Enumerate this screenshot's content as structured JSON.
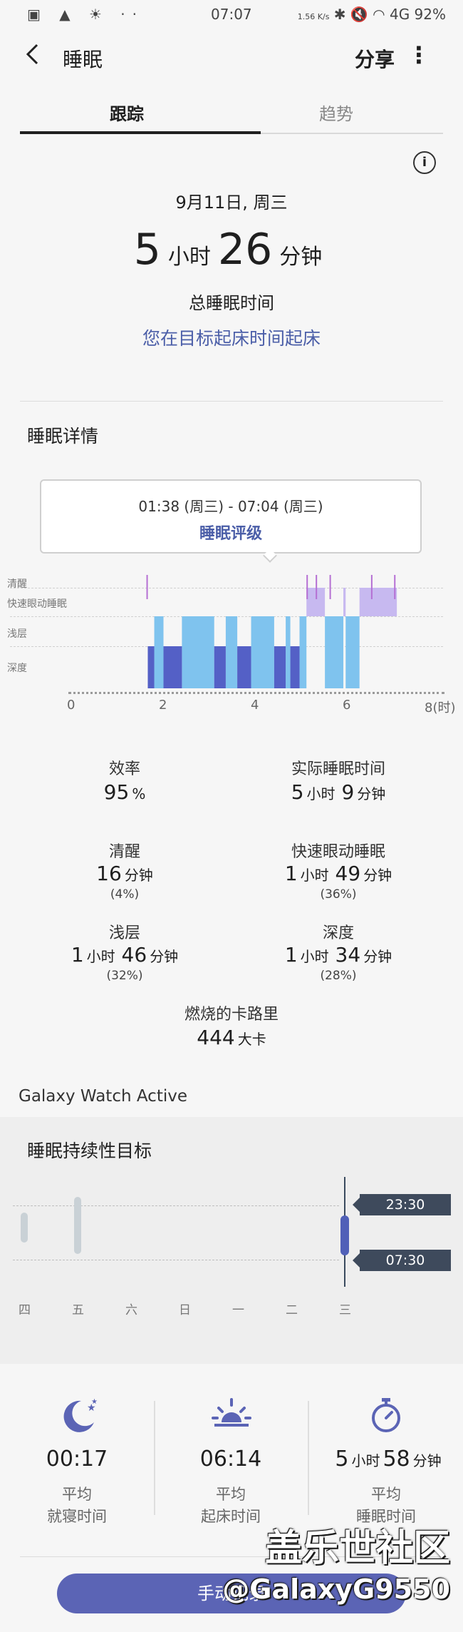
{
  "status_bar": {
    "left_icons": "▣ ▲ ☀ ··",
    "time": "07:07",
    "net_speed": "1.56 K/s",
    "right_icons": "✱ 🔇 ◠ 4G",
    "battery": "92%"
  },
  "header": {
    "title": "睡眠",
    "share_label": "分享"
  },
  "tabs": [
    {
      "label": "跟踪"
    },
    {
      "label": "趋势"
    }
  ],
  "summary": {
    "date": "9月11日, 周三",
    "hours": "5",
    "hours_unit": "小时",
    "minutes": "26",
    "minutes_unit": "分钟",
    "total_label": "总睡眠时间",
    "wake_message": "您在目标起床时间起床"
  },
  "details": {
    "title": "睡眠详情",
    "callout_range": "01:38 (周三) - 07:04 (周三)",
    "callout_rating": "睡眠评级",
    "stage_labels": [
      "清醒",
      "快速眼动睡眠",
      "浅层",
      "深度"
    ],
    "x_ticks": [
      "0",
      "2",
      "4",
      "6",
      "8(时)"
    ]
  },
  "chart_data": {
    "type": "bar",
    "stages": [
      "清醒",
      "快速眼动睡眠",
      "浅层",
      "深度"
    ],
    "x_range_hours": [
      0,
      8
    ],
    "segments": [
      {
        "stage": "深度",
        "start": 1.66,
        "end": 1.8
      },
      {
        "stage": "浅层",
        "start": 1.8,
        "end": 2.0
      },
      {
        "stage": "深度",
        "start": 2.0,
        "end": 2.4
      },
      {
        "stage": "浅层",
        "start": 2.4,
        "end": 3.1
      },
      {
        "stage": "深度",
        "start": 3.1,
        "end": 3.35
      },
      {
        "stage": "浅层",
        "start": 3.35,
        "end": 3.6
      },
      {
        "stage": "深度",
        "start": 3.6,
        "end": 3.9
      },
      {
        "stage": "浅层",
        "start": 3.9,
        "end": 4.4
      },
      {
        "stage": "深度",
        "start": 4.4,
        "end": 4.65
      },
      {
        "stage": "浅层",
        "start": 4.65,
        "end": 4.75
      },
      {
        "stage": "深度",
        "start": 4.75,
        "end": 4.95
      },
      {
        "stage": "浅层",
        "start": 4.95,
        "end": 5.1
      },
      {
        "stage": "快速眼动睡眠",
        "start": 5.1,
        "end": 5.5
      },
      {
        "stage": "浅层",
        "start": 5.5,
        "end": 5.9
      },
      {
        "stage": "快速眼动睡眠",
        "start": 5.9,
        "end": 5.95
      },
      {
        "stage": "浅层",
        "start": 5.95,
        "end": 6.25
      },
      {
        "stage": "快速眼动睡眠",
        "start": 6.25,
        "end": 7.06
      },
      {
        "stage": "清醒",
        "start": 1.63,
        "end": 1.66
      },
      {
        "stage": "清醒",
        "start": 5.1,
        "end": 5.13
      },
      {
        "stage": "清醒",
        "start": 5.3,
        "end": 5.33
      },
      {
        "stage": "清醒",
        "start": 5.6,
        "end": 5.63
      },
      {
        "stage": "清醒",
        "start": 6.5,
        "end": 6.53
      },
      {
        "stage": "清醒",
        "start": 7.0,
        "end": 7.03
      }
    ],
    "stage_colors": {
      "清醒": "#b56fd3",
      "快速眼动睡眠": "#c7b9f0",
      "浅层": "#7fc3ee",
      "深度": "#5460c6"
    }
  },
  "stats": {
    "efficiency": {
      "label": "效率",
      "value": "95",
      "unit": "%"
    },
    "actual": {
      "label": "实际睡眠时间",
      "h": "5",
      "h_unit": "小时",
      "m": "9",
      "m_unit": "分钟"
    },
    "awake": {
      "label": "清醒",
      "m": "16",
      "m_unit": "分钟",
      "pct": "(4%)"
    },
    "rem": {
      "label": "快速眼动睡眠",
      "h": "1",
      "h_unit": "小时",
      "m": "49",
      "m_unit": "分钟",
      "pct": "(36%)"
    },
    "light": {
      "label": "浅层",
      "h": "1",
      "h_unit": "小时",
      "m": "46",
      "m_unit": "分钟",
      "pct": "(32%)"
    },
    "deep": {
      "label": "深度",
      "h": "1",
      "h_unit": "小时",
      "m": "34",
      "m_unit": "分钟",
      "pct": "(28%)"
    },
    "calories": {
      "label": "燃烧的卡路里",
      "value": "444",
      "unit": "大卡"
    }
  },
  "device": "Galaxy Watch Active",
  "goal": {
    "title": "睡眠持续性目标",
    "tag_top": "23:30",
    "tag_bottom": "07:30",
    "days": [
      "四",
      "五",
      "六",
      "日",
      "一",
      "二",
      "三"
    ]
  },
  "averages": [
    {
      "icon": "moon-icon",
      "value": "00:17",
      "line1": "平均",
      "line2": "就寝时间"
    },
    {
      "icon": "sunrise-icon",
      "value": "06:14",
      "line1": "平均",
      "line2": "起床时间"
    },
    {
      "icon": "stopwatch-icon",
      "h": "5",
      "h_unit": "小时",
      "m": "58",
      "m_unit": "分钟",
      "line1": "平均",
      "line2": "睡眠时间"
    }
  ],
  "bottom_button": "手动记录",
  "watermark": {
    "line1": "盖乐世社区",
    "line2": "@GalaxyG9550"
  },
  "colors": {
    "accent": "#5b64b5",
    "deep": "#5460c6",
    "light": "#7fc3ee",
    "rem": "#c7b9f0",
    "awake": "#b56fd3"
  }
}
